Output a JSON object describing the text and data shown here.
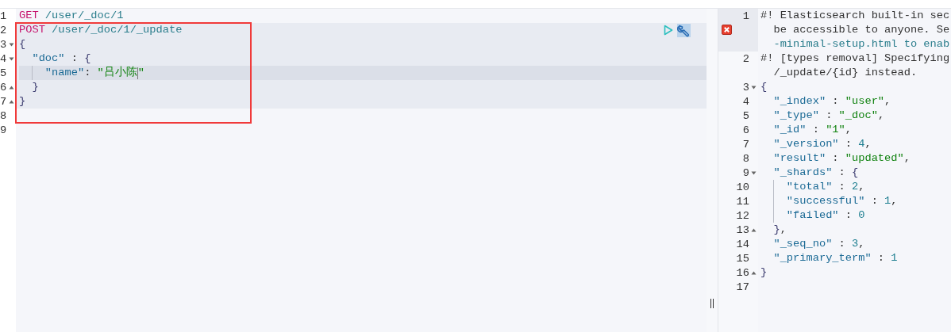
{
  "request_editor": {
    "annotation": {
      "kind": "rectangle",
      "color": "#f03a3a"
    },
    "lines": [
      {
        "number": "1",
        "selected": false,
        "active": false,
        "tokens": [
          {
            "kind": "method",
            "text": "GET"
          },
          {
            "kind": "url",
            "text": " /user/_doc/1"
          }
        ]
      },
      {
        "number": "2",
        "selected": true,
        "active": false,
        "box_start": true,
        "actions": [
          {
            "kind": "run",
            "highlighted": false
          },
          {
            "kind": "wrench",
            "highlighted": true
          }
        ],
        "tokens": [
          {
            "kind": "method",
            "text": "POST"
          },
          {
            "kind": "url",
            "text": " /user/_doc/1/_update"
          }
        ]
      },
      {
        "number": "3",
        "fold_start": true,
        "selected": true,
        "active": false,
        "tokens": [
          {
            "kind": "brace",
            "text": "{"
          }
        ]
      },
      {
        "number": "4",
        "fold_start": true,
        "selected": true,
        "active": false,
        "tokens": [
          {
            "kind": "key",
            "text": "\"doc\""
          },
          {
            "kind": "punct",
            "text": " : "
          },
          {
            "kind": "brace",
            "text": "{"
          }
        ]
      },
      {
        "number": "5",
        "selected": true,
        "active": true,
        "guide": true,
        "tokens": [
          {
            "kind": "key",
            "text": "\"name\""
          },
          {
            "kind": "punct",
            "text": ": "
          },
          {
            "kind": "string",
            "text": "\"吕小陈",
            "caret_after": true
          },
          {
            "kind": "string",
            "text": "\""
          }
        ]
      },
      {
        "number": "6",
        "fold_end": true,
        "selected": true,
        "active": false,
        "tokens": [
          {
            "kind": "brace",
            "text": "}"
          }
        ]
      },
      {
        "number": "7",
        "fold_end": true,
        "selected": true,
        "active": false,
        "tokens": [
          {
            "kind": "brace",
            "text": "}"
          }
        ]
      },
      {
        "number": "8",
        "selected": false,
        "active": false,
        "box_end": true
      },
      {
        "number": "9",
        "selected": false,
        "active": false
      }
    ]
  },
  "response_editor": {
    "lines": [
      {
        "number": "1",
        "active": true,
        "error": true,
        "tokens": [
          {
            "kind": "comment",
            "text": "#! Elasticsearch built-in sec"
          }
        ],
        "wraps": [
          [
            {
              "kind": "comment",
              "text": "be accessible to anyone. Se"
            }
          ],
          [
            {
              "kind": "link",
              "text": "-minimal-setup.html to enab"
            }
          ]
        ]
      },
      {
        "number": "2",
        "active": false,
        "tokens": [
          {
            "kind": "comment",
            "text": "#! [types removal] Specifying"
          }
        ],
        "wraps": [
          [
            {
              "kind": "comment",
              "text": "/_update/{id} instead."
            }
          ]
        ]
      },
      {
        "number": "3",
        "fold_start": true,
        "active": false,
        "tokens": [
          {
            "kind": "brace",
            "text": "{"
          }
        ]
      },
      {
        "number": "4",
        "active": false,
        "tokens": [
          {
            "kind": "key",
            "text": "\"_index\""
          },
          {
            "kind": "punct",
            "text": " : "
          },
          {
            "kind": "string",
            "text": "\"user\""
          },
          {
            "kind": "comma",
            "text": ","
          }
        ]
      },
      {
        "number": "5",
        "active": false,
        "tokens": [
          {
            "kind": "key",
            "text": "\"_type\""
          },
          {
            "kind": "punct",
            "text": " : "
          },
          {
            "kind": "string",
            "text": "\"_doc\""
          },
          {
            "kind": "comma",
            "text": ","
          }
        ]
      },
      {
        "number": "6",
        "active": false,
        "tokens": [
          {
            "kind": "key",
            "text": "\"_id\""
          },
          {
            "kind": "punct",
            "text": " : "
          },
          {
            "kind": "string",
            "text": "\"1\""
          },
          {
            "kind": "comma",
            "text": ","
          }
        ]
      },
      {
        "number": "7",
        "active": false,
        "tokens": [
          {
            "kind": "key",
            "text": "\"_version\""
          },
          {
            "kind": "punct",
            "text": " : "
          },
          {
            "kind": "number",
            "text": "4"
          },
          {
            "kind": "comma",
            "text": ","
          }
        ]
      },
      {
        "number": "8",
        "active": false,
        "tokens": [
          {
            "kind": "key",
            "text": "\"result\""
          },
          {
            "kind": "punct",
            "text": " : "
          },
          {
            "kind": "string",
            "text": "\"updated\""
          },
          {
            "kind": "comma",
            "text": ","
          }
        ]
      },
      {
        "number": "9",
        "fold_start": true,
        "active": false,
        "tokens": [
          {
            "kind": "key",
            "text": "\"_shards\""
          },
          {
            "kind": "punct",
            "text": " : "
          },
          {
            "kind": "brace",
            "text": "{"
          }
        ]
      },
      {
        "number": "10",
        "active": false,
        "guide": true,
        "tokens": [
          {
            "kind": "key",
            "text": "\"total\""
          },
          {
            "kind": "punct",
            "text": " : "
          },
          {
            "kind": "number",
            "text": "2"
          },
          {
            "kind": "comma",
            "text": ","
          }
        ]
      },
      {
        "number": "11",
        "active": false,
        "guide": true,
        "tokens": [
          {
            "kind": "key",
            "text": "\"successful\""
          },
          {
            "kind": "punct",
            "text": " : "
          },
          {
            "kind": "number",
            "text": "1"
          },
          {
            "kind": "comma",
            "text": ","
          }
        ]
      },
      {
        "number": "12",
        "active": false,
        "guide": true,
        "tokens": [
          {
            "kind": "key",
            "text": "\"failed\""
          },
          {
            "kind": "punct",
            "text": " : "
          },
          {
            "kind": "number",
            "text": "0"
          }
        ]
      },
      {
        "number": "13",
        "fold_end": true,
        "active": false,
        "tokens": [
          {
            "kind": "brace",
            "text": "}"
          },
          {
            "kind": "comma",
            "text": ","
          }
        ]
      },
      {
        "number": "14",
        "active": false,
        "tokens": [
          {
            "kind": "key",
            "text": "\"_seq_no\""
          },
          {
            "kind": "punct",
            "text": " : "
          },
          {
            "kind": "number",
            "text": "3"
          },
          {
            "kind": "comma",
            "text": ","
          }
        ]
      },
      {
        "number": "15",
        "active": false,
        "tokens": [
          {
            "kind": "key",
            "text": "\"_primary_term\""
          },
          {
            "kind": "punct",
            "text": " : "
          },
          {
            "kind": "number",
            "text": "1"
          }
        ]
      },
      {
        "number": "16",
        "fold_end": true,
        "active": false,
        "tokens": [
          {
            "kind": "brace",
            "text": "}"
          }
        ]
      },
      {
        "number": "17",
        "active": false
      }
    ]
  }
}
